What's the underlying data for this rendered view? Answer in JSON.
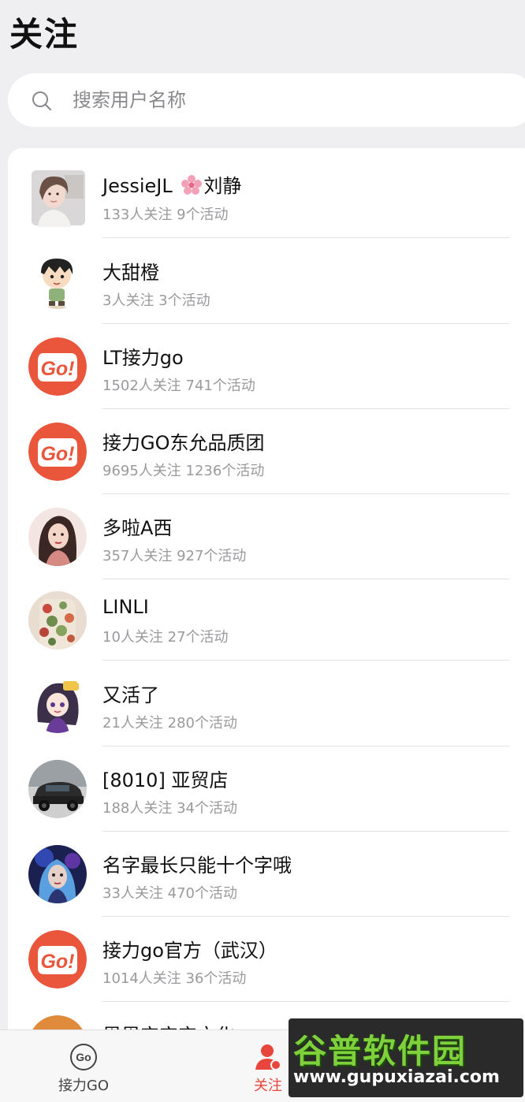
{
  "page": {
    "title": "关注"
  },
  "search": {
    "placeholder": "搜索用户名称",
    "value": ""
  },
  "follows": [
    {
      "name": "JessieJL",
      "name_suffix": "刘静",
      "meta": "133人关注 9个活动",
      "avatar": "photo-woman"
    },
    {
      "name": "大甜橙",
      "meta": "3人关注 3个活动",
      "avatar": "cartoon-boy"
    },
    {
      "name": "LT接力go",
      "meta": "1502人关注 741个活动",
      "avatar": "go-logo"
    },
    {
      "name": "接力GO东允品质团",
      "meta": "9695人关注 1236个活动",
      "avatar": "go-logo"
    },
    {
      "name": "多啦A西",
      "meta": "357人关注 927个活动",
      "avatar": "illustrated-woman"
    },
    {
      "name": "LINLI",
      "meta": "10人关注 27个活动",
      "avatar": "floral-dress"
    },
    {
      "name": "又活了",
      "meta": "21人关注 280个活动",
      "avatar": "anime-girl"
    },
    {
      "name": "[8010] 亚贸店",
      "meta": "188人关注 34个活动",
      "avatar": "car-photo"
    },
    {
      "name": "名字最长只能十个字哦",
      "meta": "33人关注 470个活动",
      "avatar": "fantasy-portrait"
    },
    {
      "name": "接力go官方（武汉）",
      "meta": "1014人关注 36个活动",
      "avatar": "go-logo"
    },
    {
      "name": "恩恩宝宝宝文化",
      "meta": "",
      "avatar": "orange-circle"
    }
  ],
  "tabbar": {
    "items": [
      {
        "label": "接力GO",
        "icon": "go-circle-icon",
        "active": false
      },
      {
        "label": "关注",
        "icon": "person-icon",
        "active": true
      }
    ]
  },
  "watermark": {
    "main": "谷普软件园",
    "url": "www.gupuxiazai.com"
  },
  "colors": {
    "accent": "#e8453c",
    "background": "#efeff1",
    "go_logo": "#e9563b",
    "meta_text": "#9a9a9e"
  }
}
